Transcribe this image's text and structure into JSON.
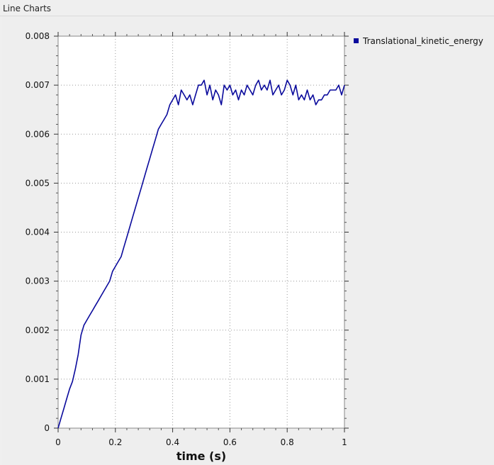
{
  "window": {
    "title": "Line Charts"
  },
  "colors": {
    "series": "#0a0a9c",
    "plot_bg": "#ffffff",
    "panel_bg": "#eeeeee"
  },
  "chart_data": {
    "type": "line",
    "xlabel": "time (s)",
    "ylabel": "",
    "xlim": [
      0,
      1
    ],
    "ylim": [
      0,
      0.008
    ],
    "xticks": [
      0,
      0.2,
      0.4,
      0.6,
      0.8,
      1
    ],
    "xtick_labels": [
      "0",
      "0.2",
      "0.4",
      "0.6",
      "0.8",
      "1"
    ],
    "yticks": [
      0,
      0.001,
      0.002,
      0.003,
      0.004,
      0.005,
      0.006,
      0.007,
      0.008
    ],
    "ytick_labels": [
      "0",
      "0.001",
      "0.002",
      "0.003",
      "0.004",
      "0.005",
      "0.006",
      "0.007",
      "0.008"
    ],
    "grid": true,
    "legend_position": "top-right",
    "series": [
      {
        "name": "Translational_kinetic_energy",
        "color": "#0a0a9c",
        "x": [
          0,
          0.01,
          0.02,
          0.03,
          0.04,
          0.05,
          0.06,
          0.07,
          0.08,
          0.09,
          0.1,
          0.11,
          0.12,
          0.13,
          0.14,
          0.15,
          0.16,
          0.17,
          0.18,
          0.19,
          0.2,
          0.21,
          0.22,
          0.23,
          0.24,
          0.25,
          0.26,
          0.27,
          0.28,
          0.29,
          0.3,
          0.31,
          0.32,
          0.33,
          0.34,
          0.35,
          0.36,
          0.37,
          0.38,
          0.39,
          0.4,
          0.41,
          0.42,
          0.43,
          0.44,
          0.45,
          0.46,
          0.47,
          0.48,
          0.49,
          0.5,
          0.51,
          0.52,
          0.53,
          0.54,
          0.55,
          0.56,
          0.57,
          0.58,
          0.59,
          0.6,
          0.61,
          0.62,
          0.63,
          0.64,
          0.65,
          0.66,
          0.67,
          0.68,
          0.69,
          0.7,
          0.71,
          0.72,
          0.73,
          0.74,
          0.75,
          0.76,
          0.77,
          0.78,
          0.79,
          0.8,
          0.81,
          0.82,
          0.83,
          0.84,
          0.85,
          0.86,
          0.87,
          0.88,
          0.89,
          0.9,
          0.91,
          0.92,
          0.93,
          0.94,
          0.95,
          0.96,
          0.97,
          0.98,
          0.99,
          1.0
        ],
        "values": [
          0,
          0.0002,
          0.0004,
          0.0006,
          0.0008,
          0.00095,
          0.0012,
          0.0015,
          0.0019,
          0.0021,
          0.0022,
          0.0023,
          0.0024,
          0.0025,
          0.0026,
          0.0027,
          0.0028,
          0.0029,
          0.003,
          0.0032,
          0.0033,
          0.0034,
          0.0035,
          0.0037,
          0.0039,
          0.0041,
          0.0043,
          0.0045,
          0.0047,
          0.0049,
          0.0051,
          0.0053,
          0.0055,
          0.0057,
          0.0059,
          0.0061,
          0.0062,
          0.0063,
          0.0064,
          0.0066,
          0.0067,
          0.0068,
          0.0066,
          0.0069,
          0.0068,
          0.0067,
          0.0068,
          0.0066,
          0.0068,
          0.007,
          0.007,
          0.0071,
          0.0068,
          0.007,
          0.0067,
          0.0069,
          0.0068,
          0.0066,
          0.007,
          0.0069,
          0.007,
          0.0068,
          0.0069,
          0.0067,
          0.0069,
          0.0068,
          0.007,
          0.0069,
          0.0068,
          0.007,
          0.0071,
          0.0069,
          0.007,
          0.0069,
          0.0071,
          0.0068,
          0.0069,
          0.007,
          0.0068,
          0.0069,
          0.0071,
          0.007,
          0.0068,
          0.007,
          0.0067,
          0.0068,
          0.0067,
          0.0069,
          0.0067,
          0.0068,
          0.0066,
          0.0067,
          0.0067,
          0.0068,
          0.0068,
          0.0069,
          0.0069,
          0.0069,
          0.007,
          0.0068,
          0.007
        ]
      }
    ]
  }
}
